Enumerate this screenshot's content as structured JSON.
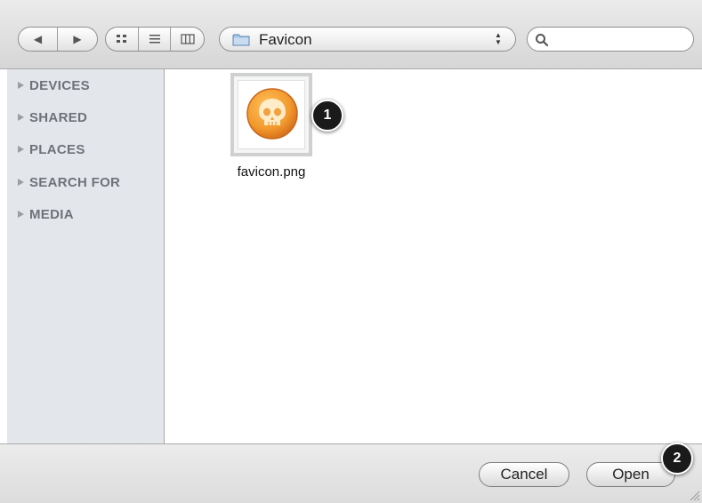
{
  "toolbar": {
    "back_glyph": "◀",
    "forward_glyph": "▶",
    "view_icons": [
      "icon-view-icon",
      "list-view-icon",
      "column-view-icon"
    ],
    "path_popup_label": "Favicon",
    "search_placeholder": ""
  },
  "sidebar": {
    "items": [
      {
        "label": "DEVICES"
      },
      {
        "label": "SHARED"
      },
      {
        "label": "PLACES"
      },
      {
        "label": "SEARCH FOR"
      },
      {
        "label": "MEDIA"
      }
    ]
  },
  "files": [
    {
      "name": "favicon.png",
      "icon": "skull-icon"
    }
  ],
  "callouts": [
    "1",
    "2"
  ],
  "buttons": {
    "cancel_label": "Cancel",
    "open_label": "Open"
  },
  "colors": {
    "sidebar_bg": "#e3e6ea",
    "sidebar_text": "#6f7278",
    "skull_orange": "#f29a2e"
  }
}
